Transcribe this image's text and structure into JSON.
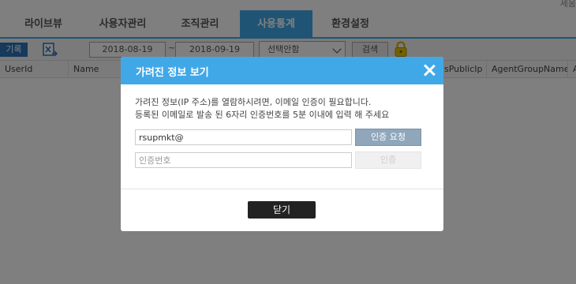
{
  "app": {
    "top_right_text": "세움",
    "tabs": [
      {
        "label": "라이브뷰"
      },
      {
        "label": "사용자관리"
      },
      {
        "label": "조직관리"
      },
      {
        "label": "사용통계",
        "active": true
      },
      {
        "label": "환경설정"
      }
    ],
    "toolbar": {
      "record_button": "기록",
      "start_date": "2018-08-19",
      "date_separator": "~",
      "end_date": "2018-09-19",
      "select_value": "선택안함",
      "search_button": "검색"
    },
    "grid_columns": [
      {
        "label": "UserId"
      },
      {
        "label": "Name"
      },
      {
        "label": "sPublicIp"
      },
      {
        "label": "AgentGroupName"
      },
      {
        "label": "A"
      }
    ]
  },
  "modal": {
    "title": "가려진 정보 보기",
    "description_line1": "가려진 정보(IP 주소)를 열람하시려면, 이메일 인증이 필요합니다.",
    "description_line2": "등록된 이메일로 발송 된 6자리 인증번호를 5분 이내에 입력 해 주세요",
    "email_value": "rsupmkt@",
    "code_placeholder": "인증번호",
    "request_button": "인증 요청",
    "verify_button": "인증",
    "close_button": "닫기"
  },
  "colors": {
    "accent": "#41a8e8",
    "overlay": "rgba(0,0,0,0.5)",
    "request_button": "#8fa6bb",
    "close_button": "#222222"
  }
}
